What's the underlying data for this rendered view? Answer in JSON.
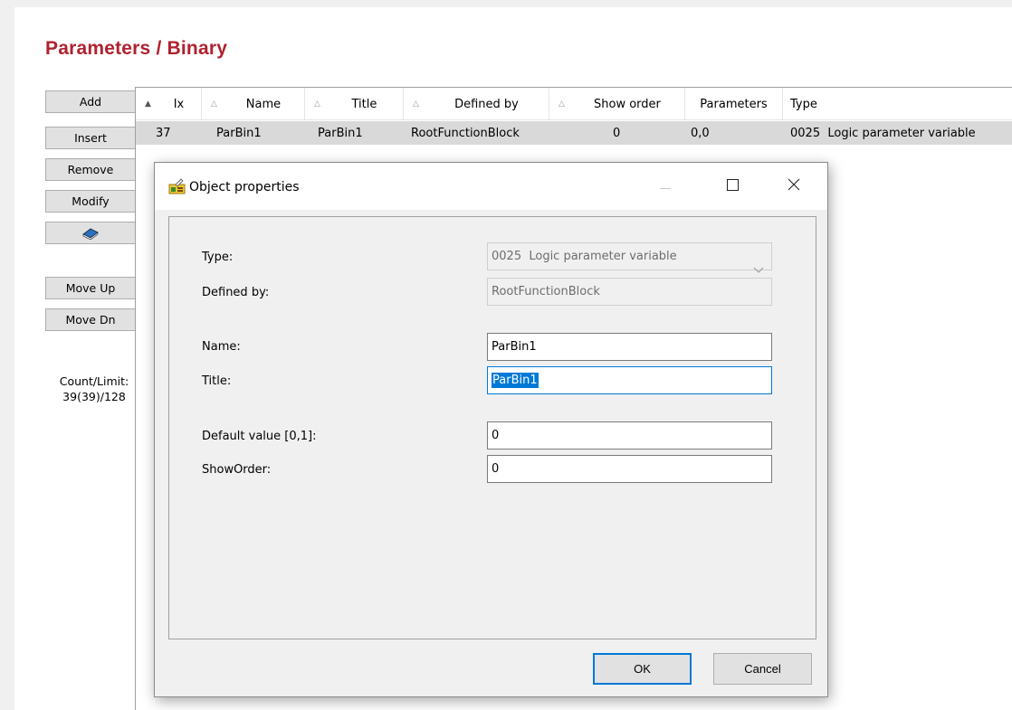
{
  "page": {
    "title": "Parameters / Binary"
  },
  "sidebar": {
    "buttons": {
      "add": "Add",
      "insert": "Insert",
      "remove": "Remove",
      "modify": "Modify",
      "move_up": "Move Up",
      "move_dn": "Move Dn"
    },
    "help_icon": "book-icon",
    "count_label": "Count/Limit:",
    "count_value": "39(39)/128"
  },
  "grid": {
    "columns": [
      "Ix",
      "Name",
      "Title",
      "Defined by",
      "Show order",
      "Parameters",
      "Type"
    ],
    "rows": [
      {
        "ix": "37",
        "name": "ParBin1",
        "title": "ParBin1",
        "defined_by": "RootFunctionBlock",
        "show_order": "0",
        "parameters": "0,0",
        "type": "0025  Logic parameter variable"
      }
    ]
  },
  "dialog": {
    "title": "Object properties",
    "icon": "object-properties-icon",
    "fields": {
      "type_label": "Type:",
      "type_value": "0025  Logic parameter variable",
      "defined_by_label": "Defined by:",
      "defined_by_value": "RootFunctionBlock",
      "name_label": "Name:",
      "name_value": "ParBin1",
      "title_label": "Title:",
      "title_value": "ParBin1",
      "default_label": "Default value [0,1]:",
      "default_value": "0",
      "showorder_label": "ShowOrder:",
      "showorder_value": "0"
    },
    "buttons": {
      "ok": "OK",
      "cancel": "Cancel"
    }
  },
  "colors": {
    "title_red": "#b0212f",
    "selection_blue": "#0078d7",
    "row_selected": "#d9d9d9"
  }
}
